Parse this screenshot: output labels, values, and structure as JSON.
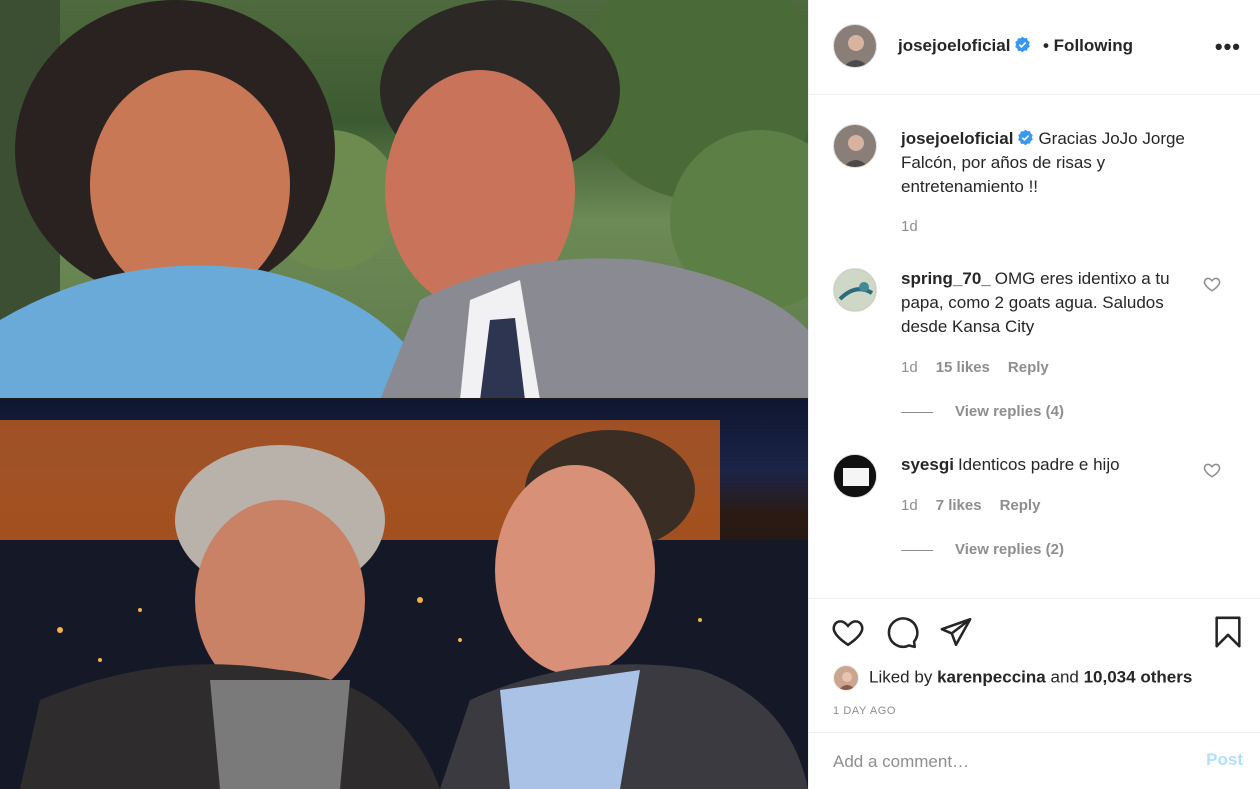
{
  "post": {
    "photo_icon": "photo-collage",
    "author": "josejoeloficial",
    "follow_status": "• Following",
    "more_icon": "more-horizontal-icon",
    "more_label": "•••"
  },
  "caption": {
    "username": "josejoeloficial",
    "text": "Gracias JoJo Jorge Falcón, por años de risas y entretenamiento !!",
    "time": "1d"
  },
  "comments": [
    {
      "username": "spring_70_",
      "text": "OMG eres identixo a tu papa, como 2 goats agua. Saludos desde Kansa City",
      "time": "1d",
      "likes": "15 likes",
      "reply": "Reply",
      "view_replies": "View replies (4)"
    },
    {
      "username": "syesgi",
      "text": "Identicos padre e hijo",
      "time": "1d",
      "likes": "7 likes",
      "reply": "Reply",
      "view_replies": "View replies (2)"
    }
  ],
  "actions": {
    "like_icon": "heart-icon",
    "comment_icon": "comment-icon",
    "share_icon": "share-icon",
    "save_icon": "bookmark-icon"
  },
  "liked_by": {
    "prefix": "Liked by",
    "user": "karenpeccina",
    "and": "and",
    "others": "10,034 others"
  },
  "timestamp": "1 DAY AGO",
  "add_comment": {
    "placeholder": "Add a comment…",
    "post_label": "Post"
  },
  "colors": {
    "verified": "#3897f0",
    "post_disabled": "#b2dffc",
    "muted": "#8e8e8e",
    "text": "#262626"
  }
}
